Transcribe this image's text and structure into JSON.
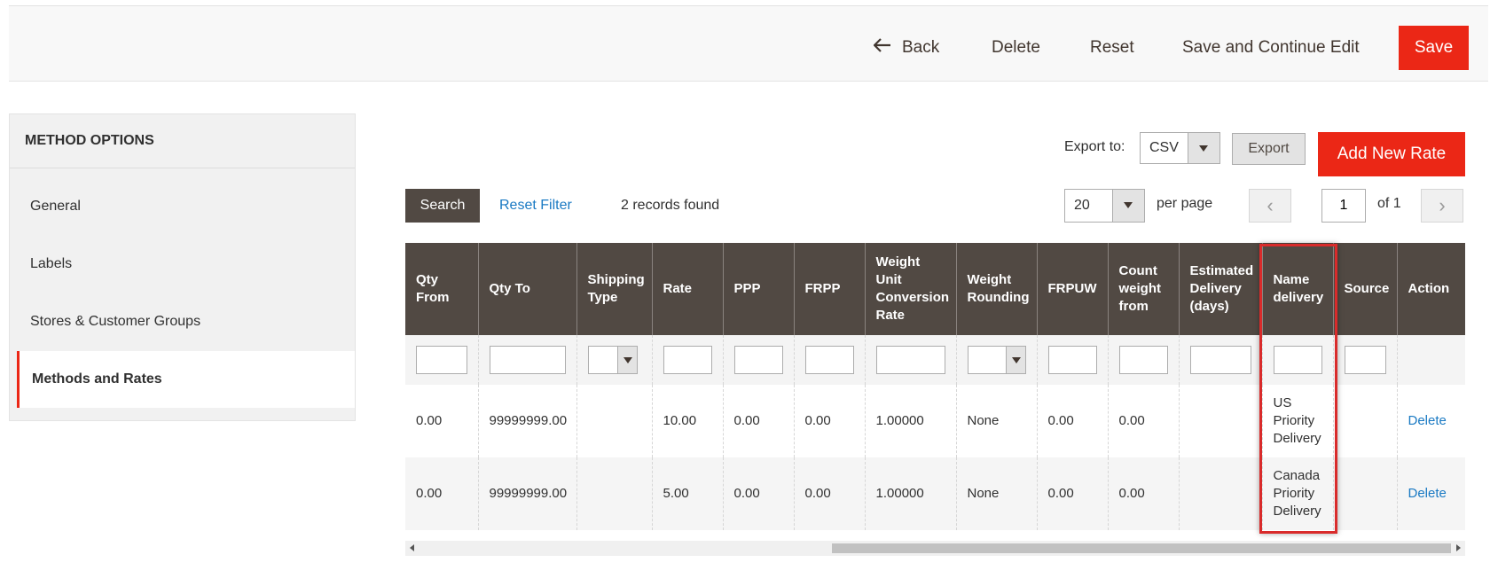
{
  "toolbar": {
    "back_label": "Back",
    "delete_label": "Delete",
    "reset_label": "Reset",
    "save_continue_label": "Save and Continue Edit",
    "save_label": "Save"
  },
  "sidebar": {
    "title": "METHOD OPTIONS",
    "items": [
      {
        "label": "General",
        "active": false
      },
      {
        "label": "Labels",
        "active": false
      },
      {
        "label": "Stores & Customer Groups",
        "active": false
      },
      {
        "label": "Methods and Rates",
        "active": true
      }
    ]
  },
  "grid_controls": {
    "export_label": "Export to:",
    "export_format": "CSV",
    "export_button": "Export",
    "add_rate_button": "Add New Rate",
    "search_button": "Search",
    "reset_filter": "Reset Filter",
    "records_found": "2 records found",
    "per_page_value": "20",
    "per_page_label": "per page",
    "current_page": "1",
    "total_pages_label": "of 1"
  },
  "table": {
    "columns": [
      [
        "Qty",
        "From"
      ],
      [
        "Qty To"
      ],
      [
        "Shipping",
        "Type"
      ],
      [
        "Rate"
      ],
      [
        "PPP"
      ],
      [
        "FRPP"
      ],
      [
        "Weight",
        "Unit",
        "Conversion",
        "Rate"
      ],
      [
        "Weight",
        "Rounding"
      ],
      [
        "FRPUW"
      ],
      [
        "Count",
        "weight",
        "from"
      ],
      [
        "Estimated",
        "Delivery",
        "(days)"
      ],
      [
        "Name",
        "delivery"
      ],
      [
        "Source"
      ],
      [
        "Action"
      ]
    ],
    "rows": [
      {
        "cells": [
          "0.00",
          "99999999.00",
          "",
          "10.00",
          "0.00",
          "0.00",
          "1.00000",
          "None",
          "0.00",
          "0.00",
          "",
          [
            "US",
            "Priority",
            "Delivery"
          ],
          "",
          "Delete"
        ]
      },
      {
        "cells": [
          "0.00",
          "99999999.00",
          "",
          "5.00",
          "0.00",
          "0.00",
          "1.00000",
          "None",
          "0.00",
          "0.00",
          "",
          [
            "Canada",
            "Priority",
            "Delivery"
          ],
          "",
          "Delete"
        ]
      }
    ]
  },
  "colors": {
    "accent": "#eb2716",
    "header_bg": "#514943",
    "link": "#1979c3",
    "highlight_border": "#d92b2b"
  }
}
